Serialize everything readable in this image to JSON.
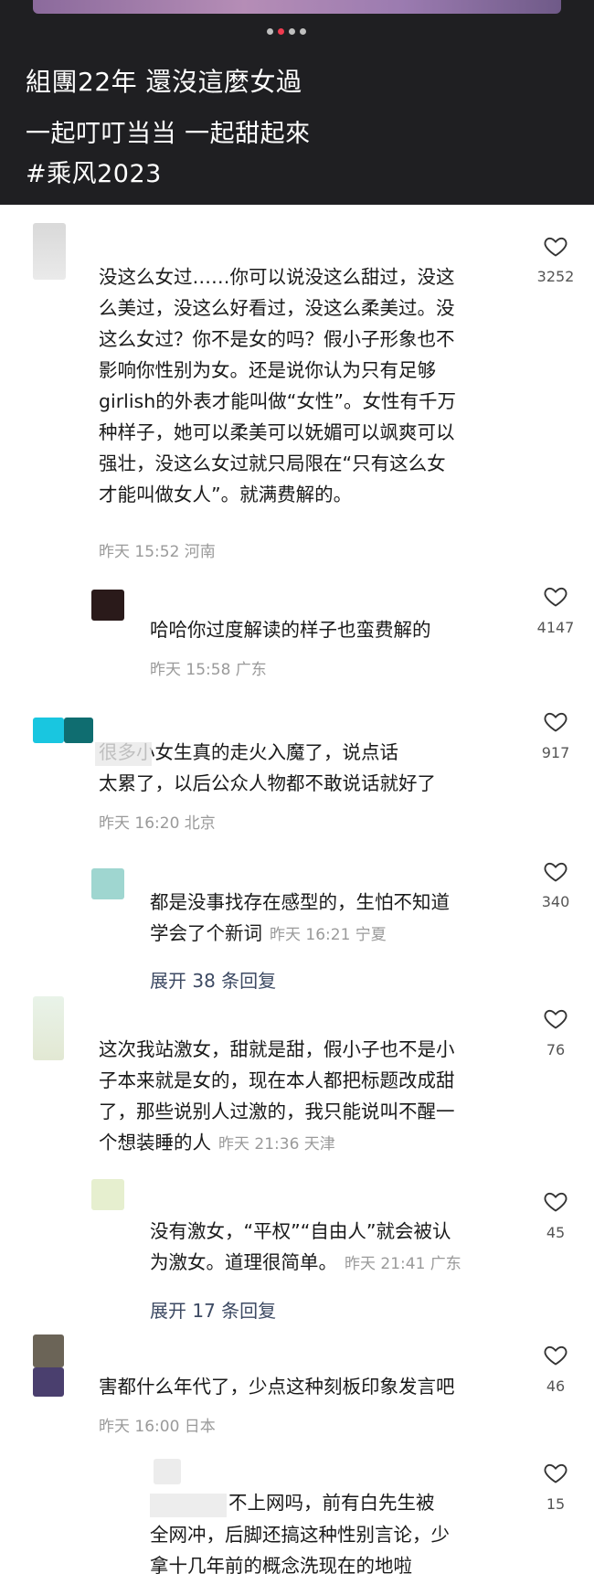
{
  "hero": {
    "title": "組團22年 還沒這麼女過",
    "subtitle": "一起叮叮当当 一起甜起來",
    "hashtag": "#乘风2023",
    "page_dots": 4,
    "active_dot": 1
  },
  "comments": [
    {
      "lines": [
        "没这么女过……你可以说没这么甜过，没这",
        "么美过，没这么好看过，没这么柔美过。没",
        "这么女过？你不是女的吗？假小子形象也不",
        "影响你性别为女。还是说你认为只有足够",
        "girlish的外表才能叫做“女性”。女性有千万",
        "种样子，她可以柔美可以妩媚可以飒爽可以",
        "强壮，没这么女过就只局限在“只有这么女",
        "才能叫做女人”。就满费解的。"
      ],
      "meta": "昨天 15:52 河南",
      "likes": "3252"
    },
    {
      "lines": [
        "哈哈你过度解读的样子也蛮费解的"
      ],
      "meta": "昨天 15:58 广东",
      "likes": "4147"
    },
    {
      "lines": [
        "很多小女生真的走火入魔了，说点话",
        "太累了，以后公众人物都不敢说话就好了"
      ],
      "meta": "昨天 16:20 北京",
      "likes": "917"
    },
    {
      "lines": [
        "都是没事找存在感型的，生怕不知道",
        "学会了个新词"
      ],
      "meta": "昨天 16:21 宁夏",
      "likes": "340",
      "expand": "展开 38 条回复"
    },
    {
      "lines": [
        "这次我站激女，甜就是甜，假小子也不是小",
        "子本来就是女的，现在本人都把标题改成甜",
        "了，那些说别人过激的，我只能说叫不醒一",
        "个想装睡的人"
      ],
      "meta": "昨天 21:36 天津",
      "likes": "76"
    },
    {
      "lines": [
        "没有激女，“平权”“自由人”就会被认",
        "为激女。道理很简单。"
      ],
      "meta": "昨天 21:41 广东",
      "likes": "45",
      "expand": "展开 17 条回复"
    },
    {
      "lines": [
        "害都什么年代了，少点这种刻板印象发言吧"
      ],
      "meta": "昨天 16:00 日本",
      "likes": "46"
    },
    {
      "lines": [
        "不上网吗，前有白先生被",
        "全网冲，后脚还搞这种性别言论，少",
        "拿十几年前的概念洗现在的地啦"
      ],
      "meta": "",
      "likes": "15"
    }
  ],
  "colors": {
    "hero_bg": "#1f1f22",
    "dot_active": "#ef3b4f",
    "meta_gray": "#9a9a9a",
    "expand_blue": "#3d4a63"
  },
  "icons": {
    "like": "heart-outline-icon"
  }
}
